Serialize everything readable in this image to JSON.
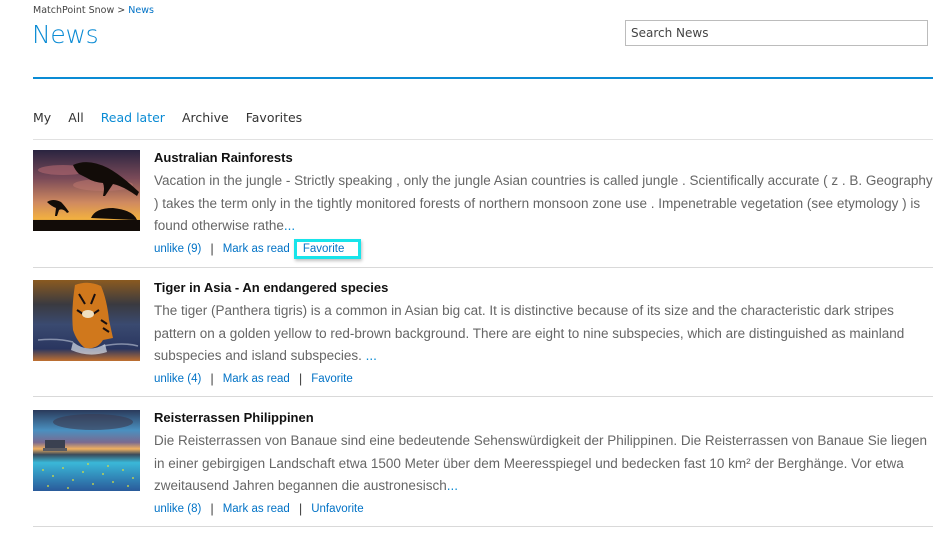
{
  "breadcrumb": {
    "root": "MatchPoint Snow",
    "separator": ">",
    "current": "News"
  },
  "page": {
    "title": "News"
  },
  "search": {
    "placeholder": "Search News",
    "value": ""
  },
  "tabs": [
    {
      "label": "My",
      "active": false
    },
    {
      "label": "All",
      "active": false
    },
    {
      "label": "Read later",
      "active": true
    },
    {
      "label": "Archive",
      "active": false
    },
    {
      "label": "Favorites",
      "active": false
    }
  ],
  "colors": {
    "accent": "#0a8bd4",
    "link": "#0072c6",
    "highlight": "#18e4ea"
  },
  "news": [
    {
      "title": "Australian Rainforests",
      "image": "kangaroo-sunset-image",
      "summary": "Vacation in the jungle - Strictly speaking , only the jungle Asian countries is called jungle . Scientifically accurate ( z . B. Geography ) takes the term only in the tightly monitored forests of northern monsoon zone use . Impenetrable vegetation (see etymology ) is found otherwise rathe",
      "more": "...",
      "unlike": "unlike (9)",
      "mark_read": "Mark as read",
      "favorite": "Favorite",
      "favorite_highlighted": true
    },
    {
      "title": "Tiger in Asia - An endangered species",
      "image": "tiger-in-water-image",
      "summary": "The tiger (Panthera tigris) is a common in Asian big cat. It is distinctive because of its size and the characteristic dark stripes pattern on a golden yellow to red-brown background. There are eight to nine subspecies, which are distinguished as mainland subspecies and island subspecies. ",
      "more": "...",
      "unlike": "unlike (4)",
      "mark_read": "Mark as read",
      "favorite": "Favorite",
      "favorite_highlighted": false
    },
    {
      "title": "Reisterrassen Philippinen",
      "image": "rice-terraces-image",
      "summary": "Die Reisterrassen von Banaue sind eine bedeutende Sehenswürdigkeit der Philippinen. Die Reisterrassen von Banaue Sie liegen in einer gebirgigen Landschaft etwa 1500 Meter über dem Meeresspiegel und bedecken fast 10 km² der Berghänge. Vor etwa zweitausend Jahren begannen die austronesisch",
      "more": "...",
      "unlike": "unlike (8)",
      "mark_read": "Mark as read",
      "favorite": "Unfavorite",
      "favorite_highlighted": false
    }
  ]
}
